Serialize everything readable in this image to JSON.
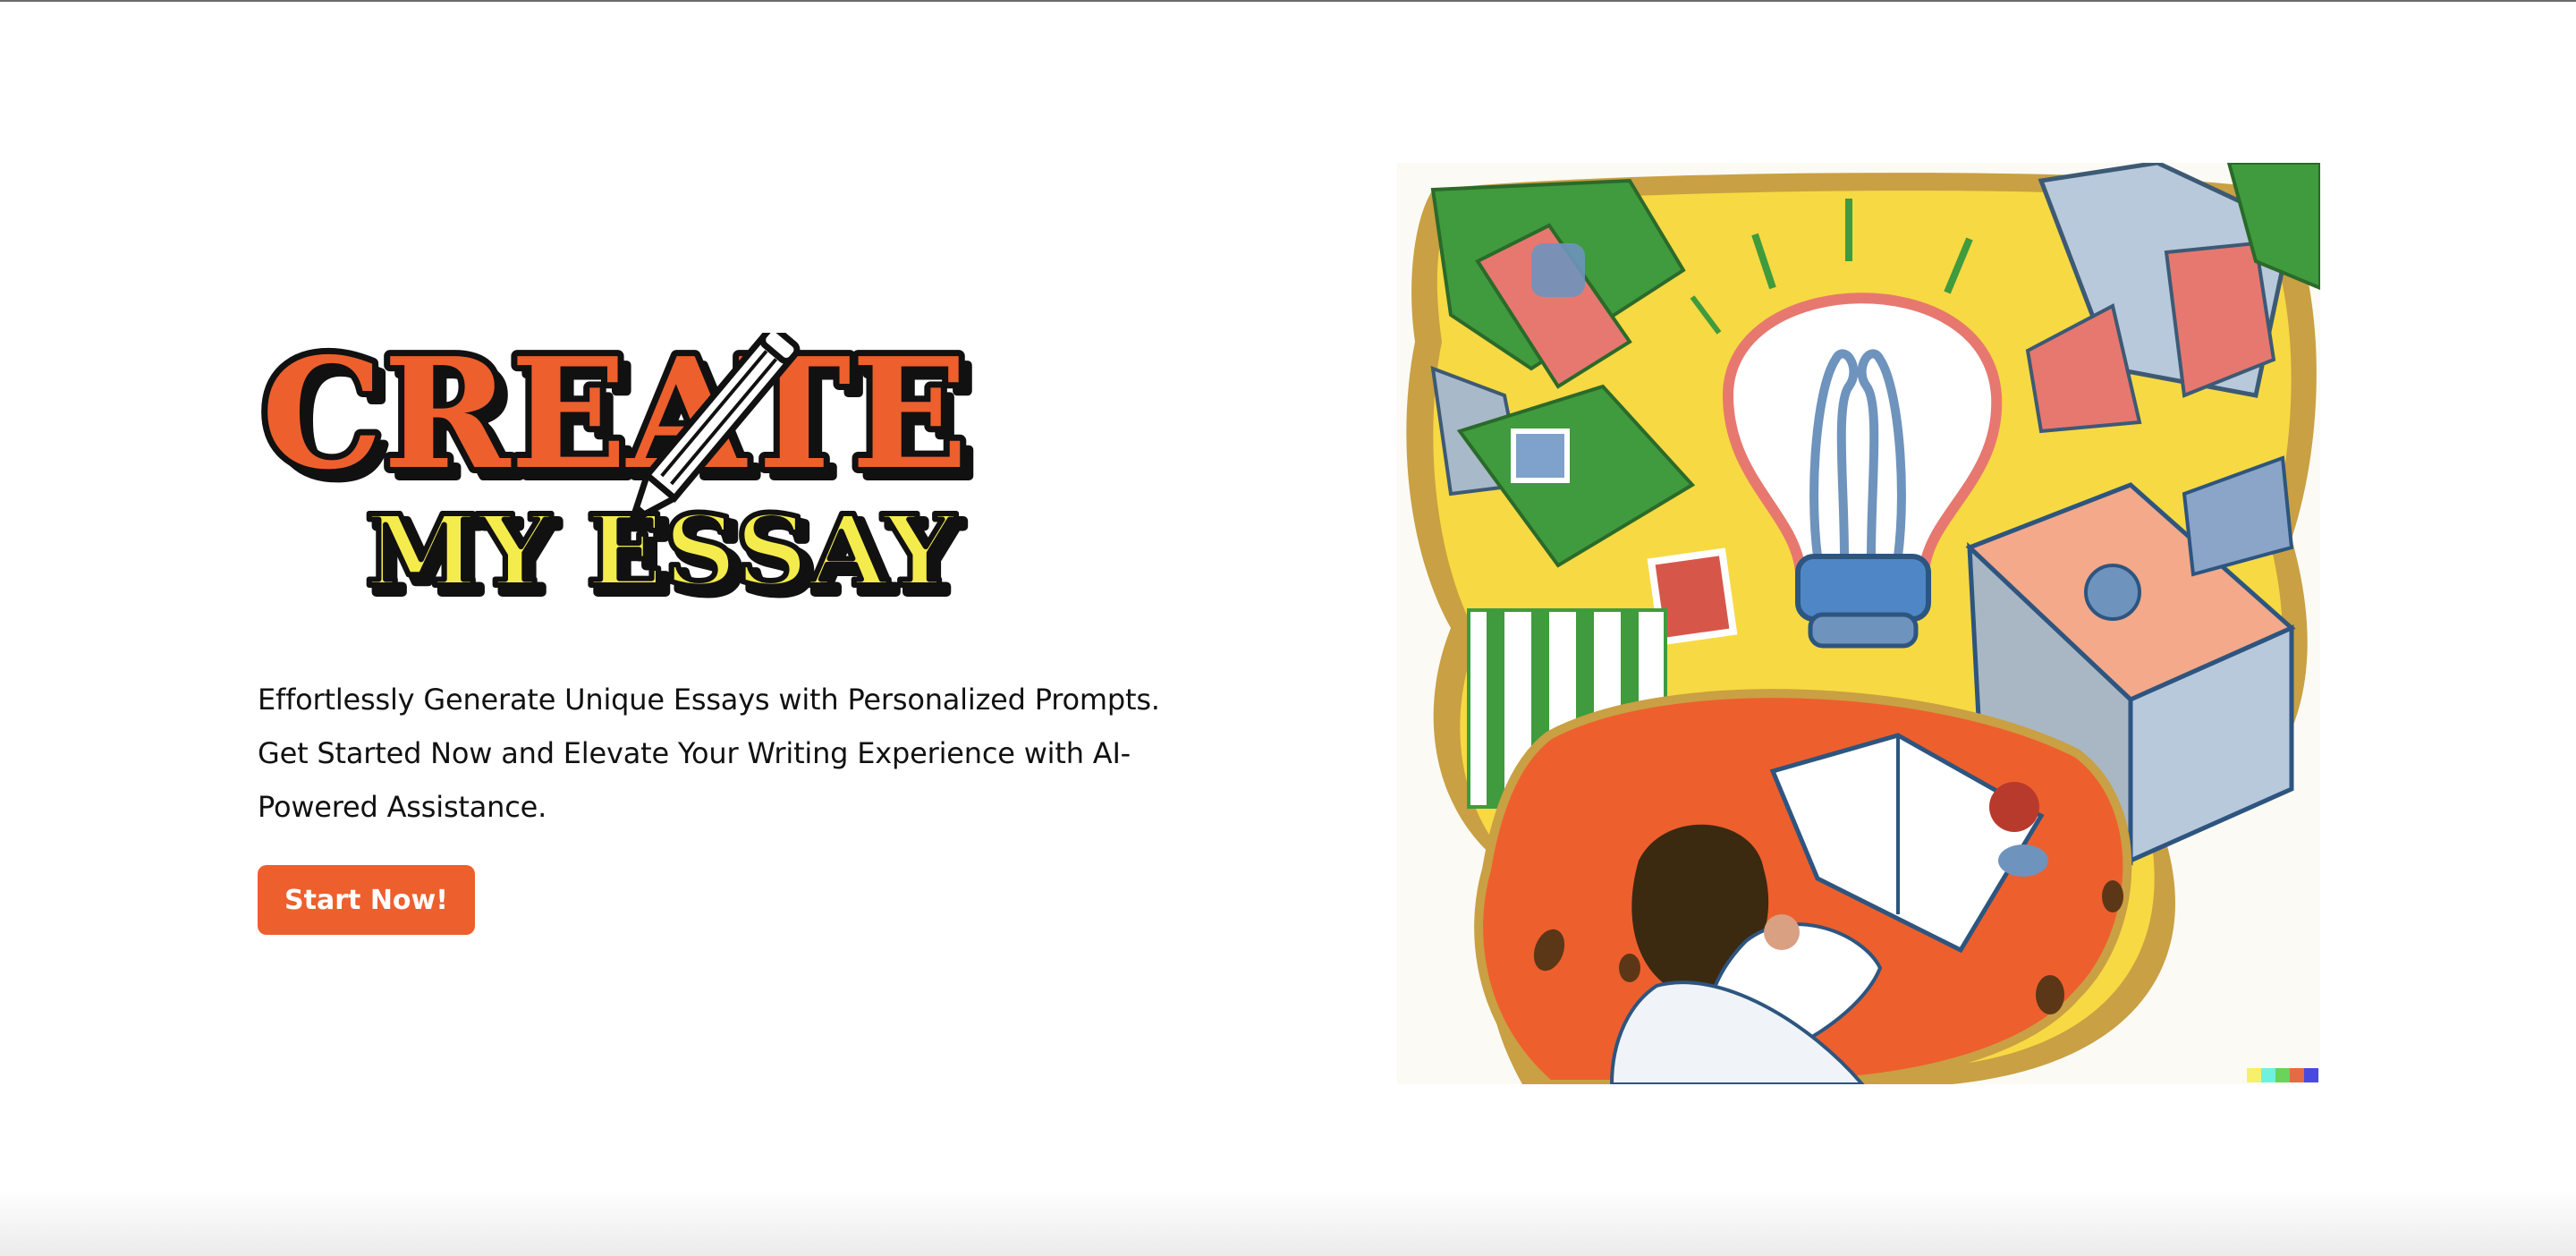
{
  "logo": {
    "line1": "CREATE",
    "line2": "MY ESSAY",
    "colors": {
      "line1_fill": "#ee5f2e",
      "line2_fill": "#f4ec4c",
      "outline": "#111111"
    },
    "icon": "pencil-icon"
  },
  "hero": {
    "description": "Effortlessly Generate Unique Essays with Personalized Prompts. Get Started Now and Elevate Your Writing Experience with AI-Powered Assistance.",
    "cta_label": "Start Now!",
    "accent_color": "#ee5f2e"
  },
  "illustration": {
    "subject": "lightbulb-icon",
    "palette": [
      "#f7d943",
      "#ee5f2e",
      "#3f9b3d",
      "#6e93bd",
      "#e7786f",
      "#c8a14a"
    ]
  }
}
